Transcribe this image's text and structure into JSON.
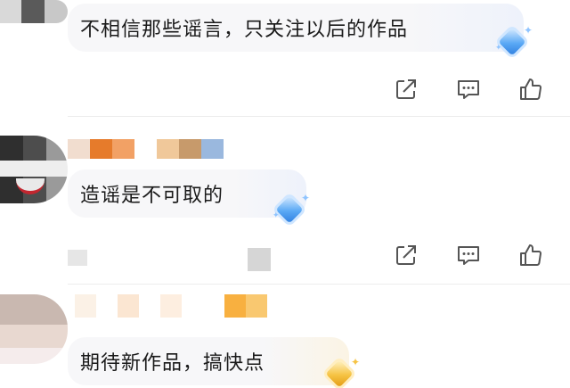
{
  "comments": [
    {
      "text": "不相信那些谣言，只关注以后的作品"
    },
    {
      "text": "造谣是不可取的"
    },
    {
      "text": "期待新作品，搞快点"
    }
  ],
  "icons": {
    "share": "share-icon",
    "comment": "comment-icon",
    "like": "thumbs-up-icon",
    "badge_blue": "blue-diamond-badge-icon",
    "badge_gold": "gold-diamond-badge-icon"
  },
  "colors": {
    "bubble_bg": "#f7f7f9",
    "text": "#1a1a1a",
    "icon": "#555555",
    "badge_blue": "#5aa9f5",
    "badge_gold": "#f6c343"
  },
  "usernames_pixelated": [
    {
      "blocks": [
        "#f1ddcf",
        "#e67b2b",
        "#f2a165",
        "#ffffff",
        "#f0c89a",
        "#c79a6b",
        "#9ab8de"
      ]
    },
    {
      "blocks": [
        "#fbf1e6",
        "#ffffff",
        "#fbe6d2",
        "#ffffff",
        "#fdeee0",
        "#ffffff",
        "#ffffff",
        "#f8b040",
        "#f9c870"
      ]
    }
  ]
}
